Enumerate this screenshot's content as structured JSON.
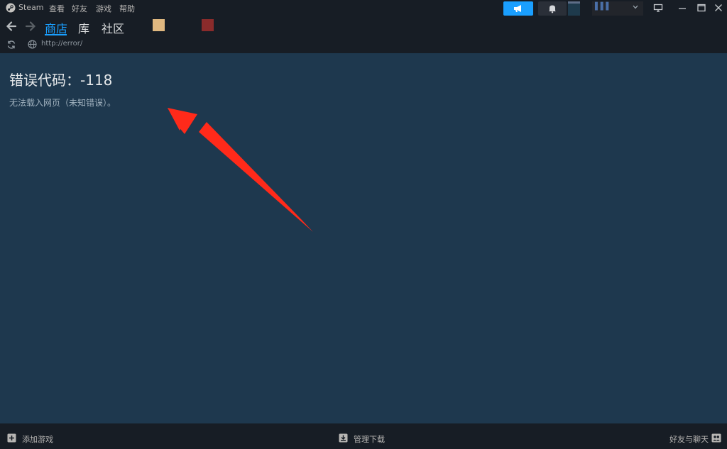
{
  "menubar": {
    "app_name": "Steam",
    "items": [
      "查看",
      "好友",
      "游戏",
      "帮助"
    ]
  },
  "user": {
    "name": "▌▌▌"
  },
  "nav": {
    "tabs": [
      "商店",
      "库",
      "社区"
    ],
    "active_tab": "商店"
  },
  "url": {
    "value": "http://error/"
  },
  "error": {
    "title": "错误代码：-118",
    "description": "无法载入网页（未知错误）。"
  },
  "bottom": {
    "add_game": "添加游戏",
    "manage_downloads": "管理下载",
    "friends_chat": "好友与聊天"
  },
  "colors": {
    "accent": "#1a9fff",
    "content_bg": "#1e384e",
    "chrome_bg": "#171d25",
    "annotation_arrow": "#ff2a1a"
  },
  "icons": [
    "steam-logo-icon",
    "megaphone-icon",
    "bell-icon",
    "monitor-icon",
    "minimize-icon",
    "maximize-icon",
    "close-icon",
    "back-arrow-icon",
    "forward-arrow-icon",
    "reload-icon",
    "globe-icon",
    "plus-icon",
    "download-icon",
    "friends-icon"
  ]
}
